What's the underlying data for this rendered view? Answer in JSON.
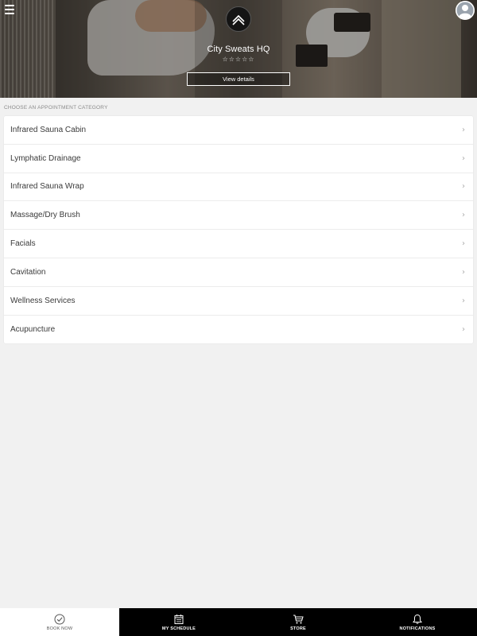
{
  "header": {
    "business_name": "City Sweats HQ",
    "rating_stars": "☆☆☆☆☆",
    "view_details_label": "View details",
    "menu_icon": "hamburger-menu-icon",
    "avatar_icon": "user-avatar-icon"
  },
  "categories": {
    "section_label": "CHOOSE AN APPOINTMENT CATEGORY",
    "items": [
      {
        "label": "Infrared Sauna Cabin"
      },
      {
        "label": "Lymphatic Drainage"
      },
      {
        "label": "Infrared Sauna Wrap"
      },
      {
        "label": "Massage/Dry Brush"
      },
      {
        "label": "Facials"
      },
      {
        "label": "Cavitation"
      },
      {
        "label": "Wellness Services"
      },
      {
        "label": "Acupuncture"
      }
    ],
    "chevron_glyph": "›"
  },
  "bottom_nav": {
    "items": [
      {
        "label": "BOOK NOW",
        "icon": "checkmark-circle-icon",
        "active": true
      },
      {
        "label": "MY SCHEDULE",
        "icon": "calendar-icon",
        "active": false
      },
      {
        "label": "STORE",
        "icon": "shopping-cart-icon",
        "active": false
      },
      {
        "label": "NOTIFICATIONS",
        "icon": "bell-icon",
        "active": false
      }
    ]
  },
  "colors": {
    "nav_background": "#000000",
    "page_background": "#f1f1f1",
    "card_background": "#ffffff"
  }
}
